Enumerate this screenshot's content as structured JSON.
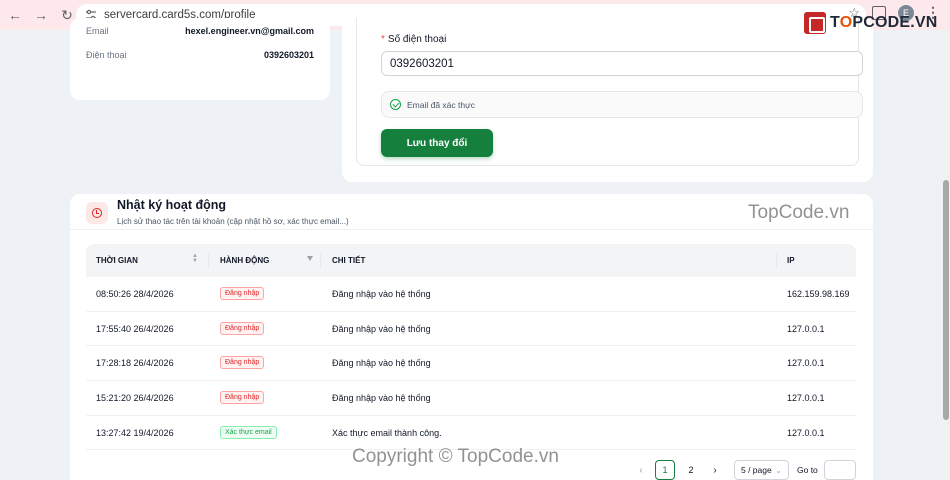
{
  "browser": {
    "url": "servercard.card5s.com/profile",
    "avatar_initial": "E"
  },
  "logo": {
    "brand_prefix": "T",
    "brand_o": "O",
    "brand_rest": "PCODE.VN"
  },
  "contact": {
    "email_label": "Email",
    "email_value": "hexel.engineer.vn@gmail.com",
    "phone_label": "Điện thoại",
    "phone_value": "0392603201"
  },
  "form": {
    "required_mark": "*",
    "phone_label": "Số điện thoại",
    "phone_value": "0392603201",
    "verified_text": "Email đã xác thực",
    "save_label": "Lưu thay đổi"
  },
  "activity": {
    "title": "Nhật ký hoạt động",
    "subtitle": "Lịch sử thao tác trên tài khoản (cập nhật hồ sơ, xác thực email...)",
    "columns": [
      "THỜI GIAN",
      "HÀNH ĐỘNG",
      "CHI TIẾT",
      "IP"
    ],
    "rows": [
      {
        "time": "08:50:26 28/4/2026",
        "action": "Đăng nhập",
        "detail": "Đăng nhập vào hệ thống",
        "ip": "162.159.98.169"
      },
      {
        "time": "17:55:40 26/4/2026",
        "action": "Đăng nhập",
        "detail": "Đăng nhập vào hệ thống",
        "ip": "127.0.0.1"
      },
      {
        "time": "17:28:18 26/4/2026",
        "action": "Đăng nhập",
        "detail": "Đăng nhập vào hệ thống",
        "ip": "127.0.0.1"
      },
      {
        "time": "15:21:20 26/4/2026",
        "action": "Đăng nhập",
        "detail": "Đăng nhập vào hệ thống",
        "ip": "127.0.0.1"
      },
      {
        "time": "13:27:42 19/4/2026",
        "action": "Xác thực email",
        "detail": "Xác thực email thành công.",
        "ip": "127.0.0.1"
      }
    ]
  },
  "pagination": {
    "pages": [
      "1",
      "2"
    ],
    "current": "1",
    "page_size": "5 / page",
    "goto_label": "Go to"
  },
  "watermarks": [
    "TopCode.vn",
    "Copyright © TopCode.vn"
  ],
  "colors": {
    "primary": "#15803d",
    "danger": "#dc2626"
  }
}
